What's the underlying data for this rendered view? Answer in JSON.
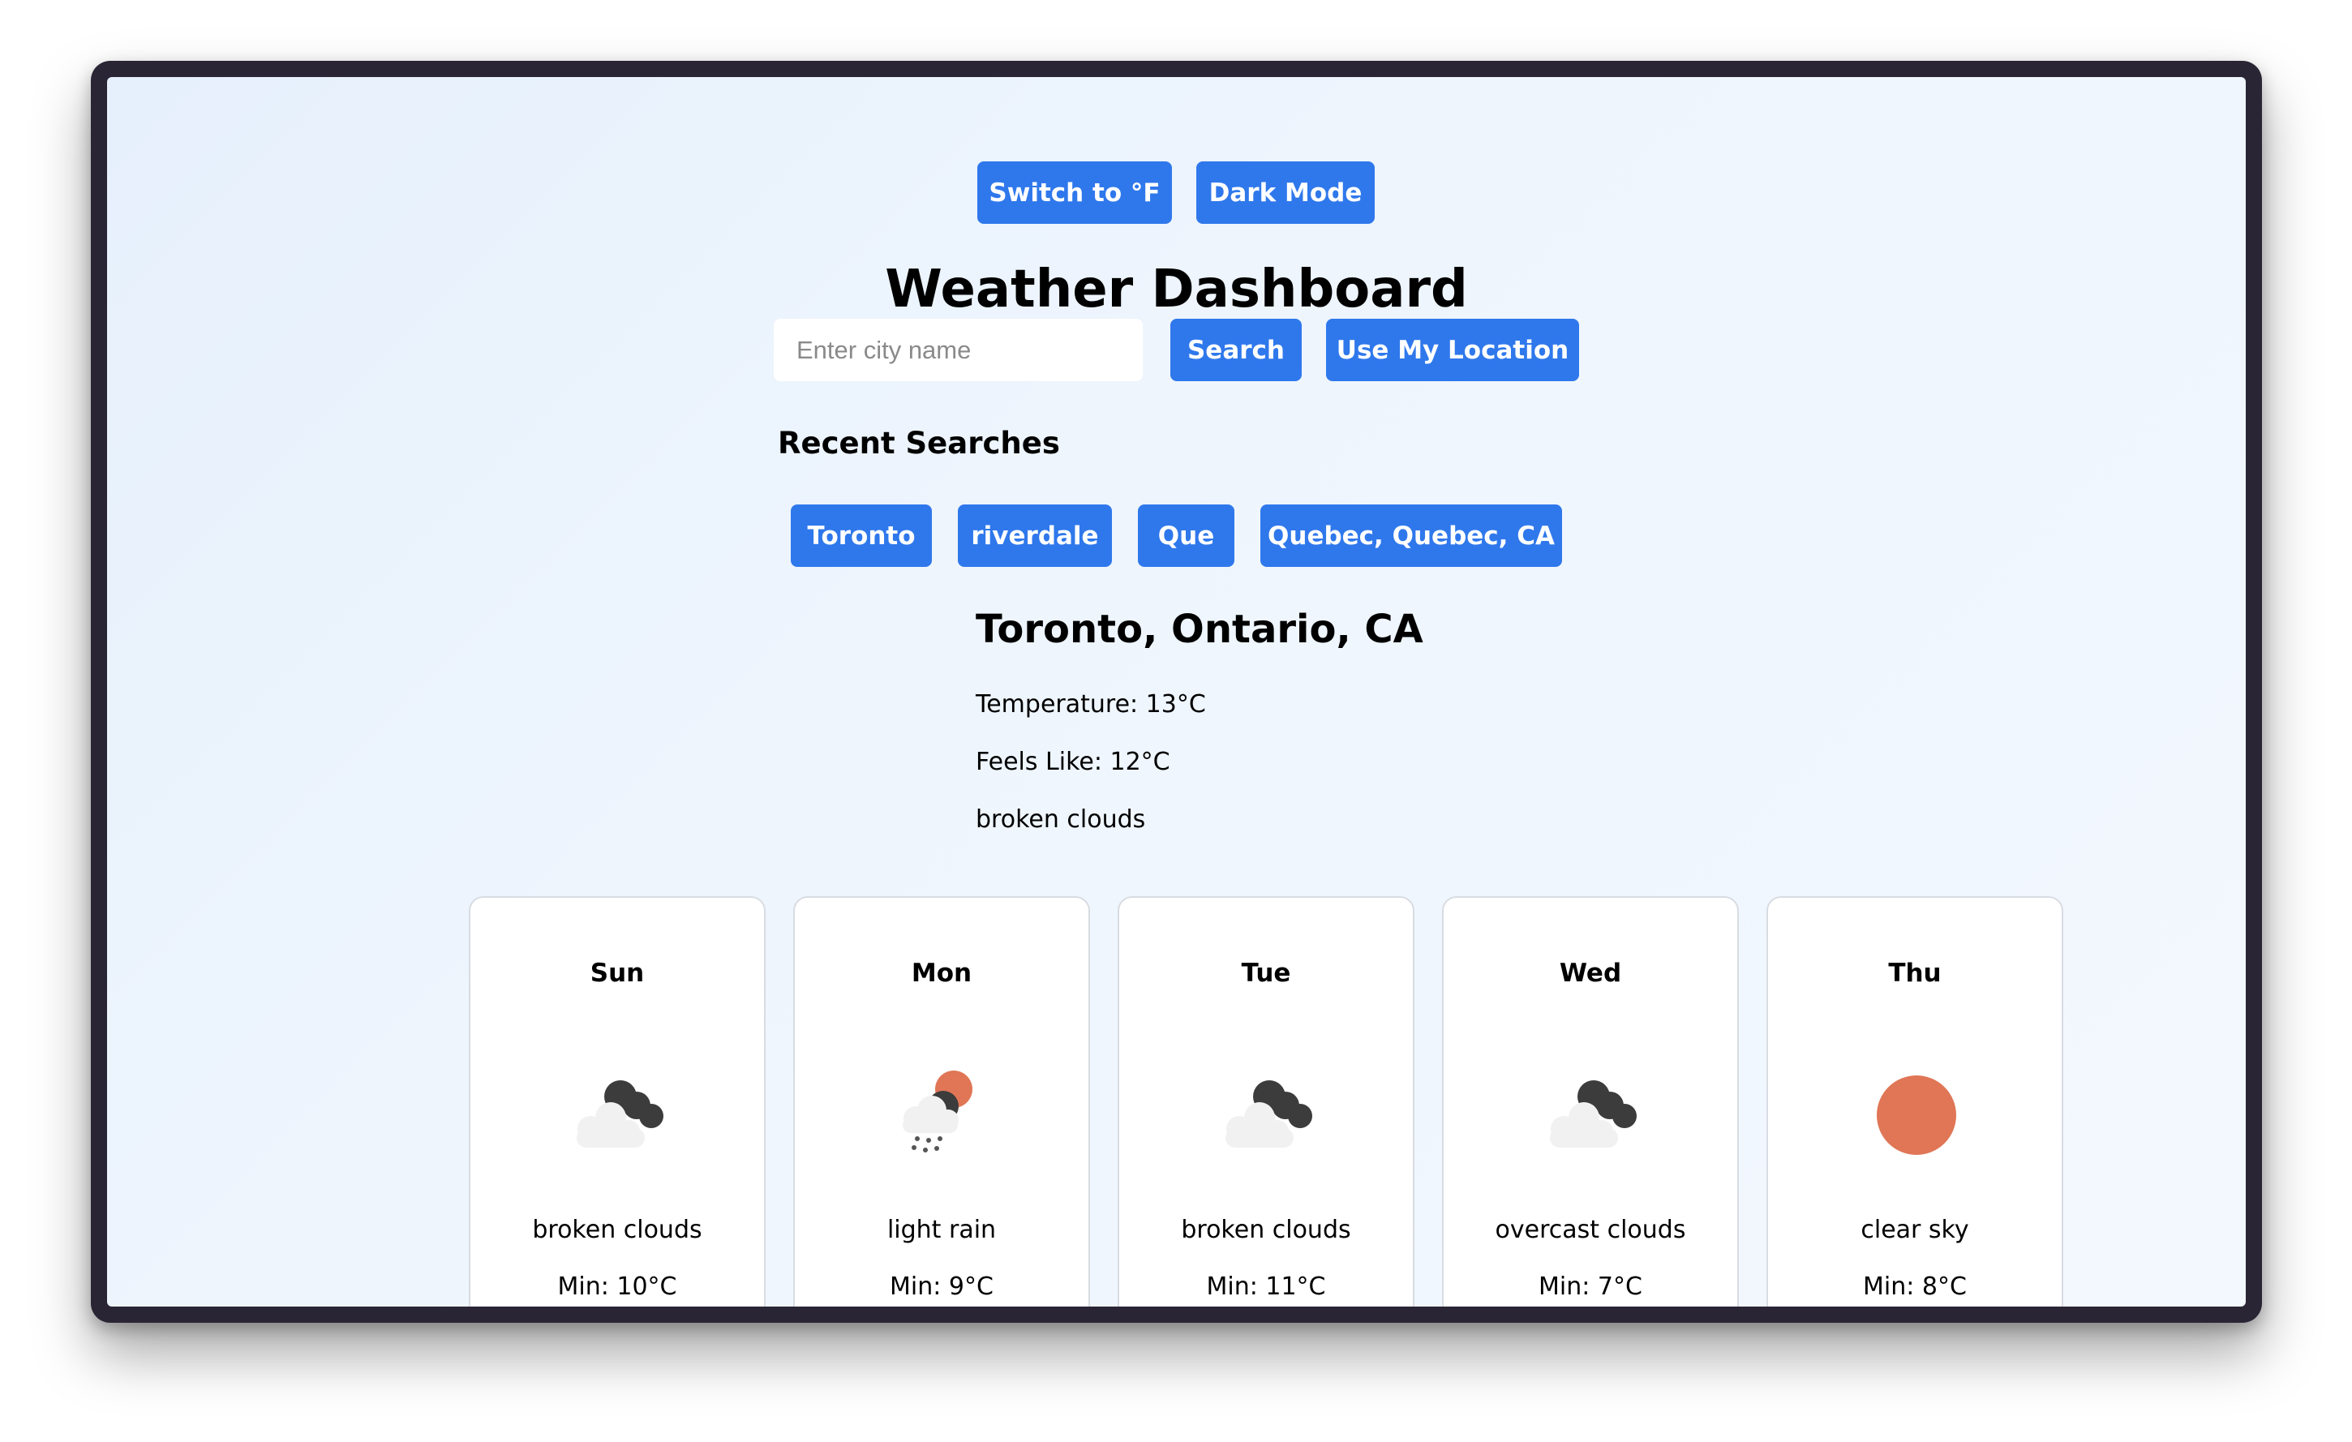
{
  "controls": {
    "unit_toggle_label": "Switch to °F",
    "theme_toggle_label": "Dark Mode"
  },
  "title": "Weather Dashboard",
  "search": {
    "placeholder": "Enter city name",
    "value": "",
    "search_label": "Search",
    "location_label": "Use My Location"
  },
  "recent": {
    "heading": "Recent Searches",
    "items": [
      "Toronto",
      "riverdale",
      "Que",
      "Quebec, Quebec, CA"
    ]
  },
  "current": {
    "location": "Toronto, Ontario, CA",
    "temperature": "Temperature: 13°C",
    "feels_like": "Feels Like: 12°C",
    "description": "broken clouds"
  },
  "forecast": [
    {
      "day": "Sun",
      "icon": "broken-clouds-icon",
      "description": "broken clouds",
      "min": "Min: 10°C"
    },
    {
      "day": "Mon",
      "icon": "light-rain-icon",
      "description": "light rain",
      "min": "Min: 9°C"
    },
    {
      "day": "Tue",
      "icon": "broken-clouds-icon",
      "description": "broken clouds",
      "min": "Min: 11°C"
    },
    {
      "day": "Wed",
      "icon": "overcast-clouds-icon",
      "description": "overcast clouds",
      "min": "Min: 7°C"
    },
    {
      "day": "Thu",
      "icon": "clear-sky-icon",
      "description": "clear sky",
      "min": "Min: 8°C"
    }
  ],
  "colors": {
    "accent": "#2f78ec",
    "sun": "#e07656",
    "cloud_dark": "#3c3c3c",
    "cloud_light": "#f1f1f1"
  }
}
